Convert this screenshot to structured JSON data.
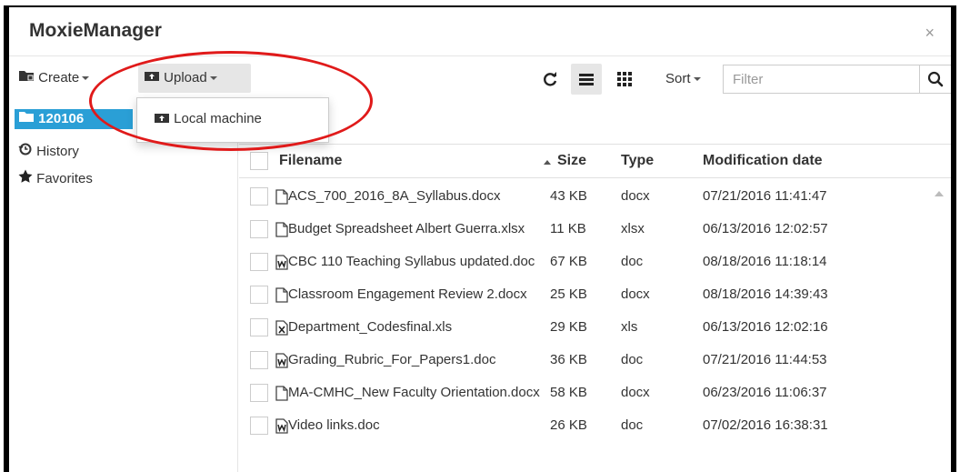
{
  "window": {
    "title": "MoxieManager",
    "close_glyph": "×"
  },
  "toolbar": {
    "create_label": "Create",
    "upload_label": "Upload",
    "sort_label": "Sort",
    "filter_placeholder": "Filter"
  },
  "upload_menu": {
    "items": [
      {
        "label": "Local machine",
        "icon": "upload-icon"
      }
    ]
  },
  "sidebar": {
    "items": [
      {
        "label": "120106",
        "icon": "folder-icon",
        "selected": true
      },
      {
        "label": "History",
        "icon": "history-icon"
      },
      {
        "label": "Favorites",
        "icon": "star-icon"
      }
    ]
  },
  "table": {
    "headers": {
      "filename": "Filename",
      "size": "Size",
      "type": "Type",
      "date": "Modification date"
    },
    "rows": [
      {
        "name": "ACS_700_2016_8A_Syllabus.docx",
        "size": "43 KB",
        "type": "docx",
        "date": "07/21/2016 11:41:47",
        "icon": "file-icon"
      },
      {
        "name": "Budget Spreadsheet Albert Guerra.xlsx",
        "size": "11 KB",
        "type": "xlsx",
        "date": "06/13/2016 12:02:57",
        "icon": "file-icon"
      },
      {
        "name": "CBC 110 Teaching Syllabus updated.doc",
        "size": "67 KB",
        "type": "doc",
        "date": "08/18/2016 11:18:14",
        "icon": "word-icon"
      },
      {
        "name": "Classroom Engagement Review 2.docx",
        "size": "25 KB",
        "type": "docx",
        "date": "08/18/2016 14:39:43",
        "icon": "file-icon"
      },
      {
        "name": "Department_Codesfinal.xls",
        "size": "29 KB",
        "type": "xls",
        "date": "06/13/2016 12:02:16",
        "icon": "excel-icon"
      },
      {
        "name": "Grading_Rubric_For_Papers1.doc",
        "size": "36 KB",
        "type": "doc",
        "date": "07/21/2016 11:44:53",
        "icon": "word-icon"
      },
      {
        "name": "MA-CMHC_New Faculty Orientation.docx",
        "size": "58 KB",
        "type": "docx",
        "date": "06/23/2016 11:06:37",
        "icon": "file-icon"
      },
      {
        "name": "Video links.doc",
        "size": "26 KB",
        "type": "doc",
        "date": "07/02/2016 16:38:31",
        "icon": "word-icon"
      }
    ]
  },
  "colors": {
    "accent": "#2a9fd6",
    "annotation": "#e01a1a"
  }
}
